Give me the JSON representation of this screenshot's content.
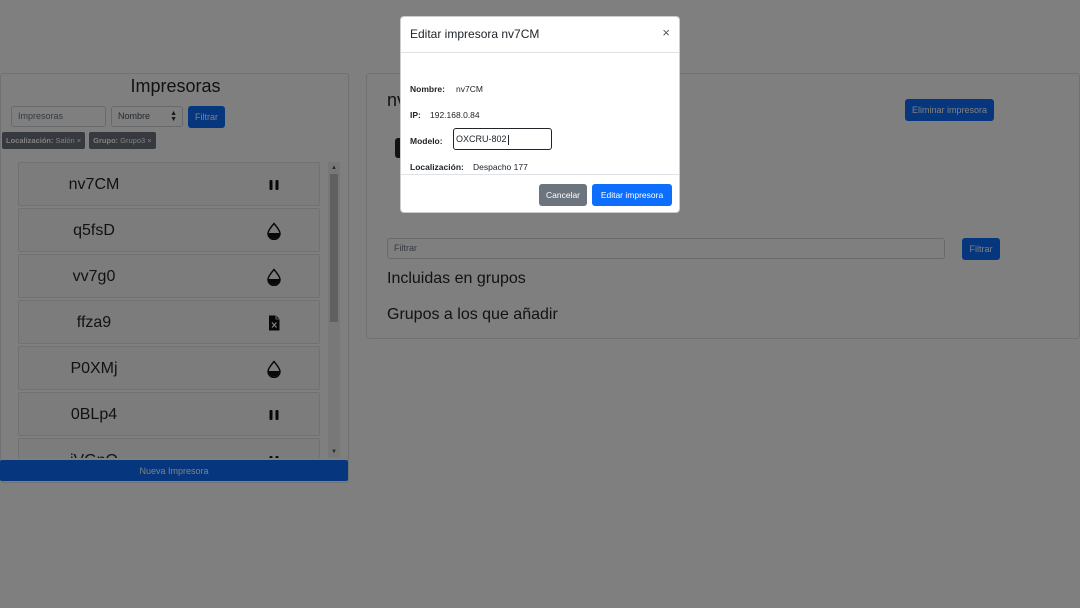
{
  "left": {
    "title": "Impresoras",
    "search_placeholder": "Impresoras",
    "sort_value": "Nombre",
    "filter_label": "Filtrar",
    "chips": [
      {
        "key": "Localización:",
        "value": "Salón ×"
      },
      {
        "key": "Grupo:",
        "value": "Grupo3 ×"
      }
    ],
    "printers": [
      {
        "name": "nv7CM",
        "icon": "pause-icon"
      },
      {
        "name": "q5fsD",
        "icon": "ink-drop-icon"
      },
      {
        "name": "vv7g0",
        "icon": "ink-drop-icon"
      },
      {
        "name": "ffza9",
        "icon": "document-error-icon"
      },
      {
        "name": "P0XMj",
        "icon": "ink-drop-icon"
      },
      {
        "name": "0BLp4",
        "icon": "pause-icon"
      },
      {
        "name": "jVGnO",
        "icon": "pause-icon"
      }
    ],
    "new_printer_label": "Nueva Impresora"
  },
  "right": {
    "title": "nv",
    "delete_label": "Eliminar impresora",
    "filter_placeholder": "Filtrar",
    "filter_label": "Filtrar",
    "included_heading": "Incluidas en grupos",
    "add_heading": "Grupos a los que añadir"
  },
  "modal": {
    "title": "Editar impresora nv7CM",
    "close": "×",
    "fields": {
      "name_label": "Nombre:",
      "name_value": "nv7CM",
      "ip_label": "IP:",
      "ip_value": "192.168.0.84",
      "model_label": "Modelo:",
      "model_value": "OXCRU-802",
      "location_label": "Localización:",
      "location_value": "Despacho 177"
    },
    "cancel_label": "Cancelar",
    "submit_label": "Editar impresora"
  },
  "colors": {
    "primary": "#0d6efd",
    "secondary": "#6c757d",
    "backdrop": "rgba(0,0,0,0.5)"
  }
}
